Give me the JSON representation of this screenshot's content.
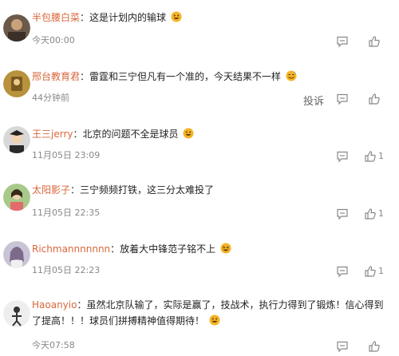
{
  "comments": [
    {
      "username": "半包腰白菜",
      "separator": "：",
      "text": "这是计划内的输球",
      "emoji": "grin-emoji",
      "time": "今天00:00",
      "report": "",
      "likes": ""
    },
    {
      "username": "邢台教育君",
      "separator": "：",
      "text": "雷霆和三宁但凡有一个准的，今天结果不一样",
      "emoji": "sweat-smile-emoji",
      "time": "44分钟前",
      "report": "投诉",
      "likes": ""
    },
    {
      "username": "王三jerry",
      "separator": "：",
      "text": "北京的问题不全是球员",
      "emoji": "grin-emoji",
      "time": "11月05日 23:09",
      "report": "",
      "likes": "1"
    },
    {
      "username": "太阳影子",
      "separator": "：",
      "text": "三宁频频打铁，这三分太难投了",
      "emoji": "",
      "time": "11月05日 22:35",
      "report": "",
      "likes": "1"
    },
    {
      "username": "Richmannnnnnn",
      "separator": "：",
      "text": "放着大中锋范子铭不上",
      "emoji": "laugh-emoji",
      "time": "11月05日 22:23",
      "report": "",
      "likes": "1"
    },
    {
      "username": "Haoanyio",
      "separator": "：",
      "text": "虽然北京队输了，实际是赢了，技战术，执行力得到了锻炼！信心得到了提高！！！球员们拼搏精神值得期待！",
      "emoji": "grin-emoji",
      "time": "今天07:58",
      "report": "",
      "likes": ""
    }
  ],
  "icons": {
    "reply": "reply-icon",
    "like": "thumbs-up-icon"
  },
  "colors": {
    "username": "#d9663a",
    "text": "#222222",
    "meta": "#888888",
    "emoji": "#f5b324"
  }
}
